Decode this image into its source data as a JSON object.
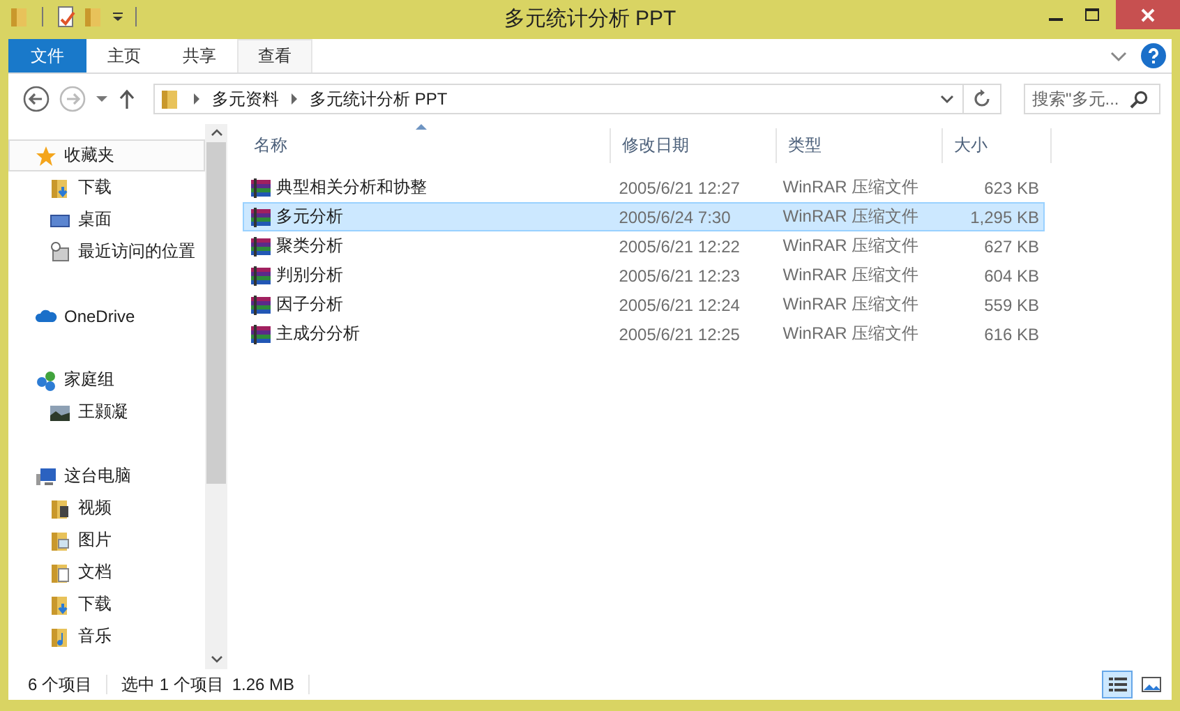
{
  "window": {
    "title": "多元统计分析 PPT"
  },
  "ribbon": {
    "tabs": [
      {
        "label": "文件",
        "kind": "file",
        "selected": false
      },
      {
        "label": "主页",
        "kind": "tab",
        "selected": false
      },
      {
        "label": "共享",
        "kind": "tab",
        "selected": false
      },
      {
        "label": "查看",
        "kind": "tab",
        "selected": true
      }
    ]
  },
  "address": {
    "path": [
      "多元资料",
      "多元统计分析 PPT"
    ]
  },
  "search": {
    "placeholder": "搜索\"多元..."
  },
  "navigation": [
    {
      "label": "收藏夹",
      "kind": "star",
      "selected": true,
      "children": [
        {
          "label": "下载",
          "kind": "download",
          "selected": false
        },
        {
          "label": "桌面",
          "kind": "desktop",
          "selected": false
        },
        {
          "label": "最近访问的位置",
          "kind": "recent",
          "selected": false
        }
      ]
    },
    {
      "label": "OneDrive",
      "kind": "cloud",
      "selected": false
    },
    {
      "label": "家庭组",
      "kind": "homegroup",
      "selected": false,
      "children": [
        {
          "label": "王颢凝",
          "kind": "photo",
          "selected": false
        }
      ]
    },
    {
      "label": "这台电脑",
      "kind": "computer",
      "selected": false,
      "children": [
        {
          "label": "视频",
          "kind": "video",
          "selected": false
        },
        {
          "label": "图片",
          "kind": "pictures",
          "selected": false
        },
        {
          "label": "文档",
          "kind": "documents",
          "selected": false
        },
        {
          "label": "下载",
          "kind": "download",
          "selected": false
        },
        {
          "label": "音乐",
          "kind": "music",
          "selected": false
        }
      ]
    }
  ],
  "table": {
    "columns": [
      {
        "label": "名称",
        "sorted": true
      },
      {
        "label": "修改日期",
        "sorted": false
      },
      {
        "label": "类型",
        "sorted": false
      },
      {
        "label": "大小",
        "sorted": false
      }
    ],
    "rows": [
      {
        "name": "典型相关分析和协整",
        "date": "2005/6/21 12:27",
        "type": "WinRAR 压缩文件",
        "size": "623 KB",
        "selected": false
      },
      {
        "name": "多元分析",
        "date": "2005/6/24 7:30",
        "type": "WinRAR 压缩文件",
        "size": "1,295 KB",
        "selected": true
      },
      {
        "name": "聚类分析",
        "date": "2005/6/21 12:22",
        "type": "WinRAR 压缩文件",
        "size": "627 KB",
        "selected": false
      },
      {
        "name": "判别分析",
        "date": "2005/6/21 12:23",
        "type": "WinRAR 压缩文件",
        "size": "604 KB",
        "selected": false
      },
      {
        "name": "因子分析",
        "date": "2005/6/21 12:24",
        "type": "WinRAR 压缩文件",
        "size": "559 KB",
        "selected": false
      },
      {
        "name": "主成分分析",
        "date": "2005/6/21 12:25",
        "type": "WinRAR 压缩文件",
        "size": "616 KB",
        "selected": false
      }
    ]
  },
  "status_bar": {
    "item_count": "6 个项目",
    "selection": "选中 1 个项目",
    "selection_size": "1.26 MB",
    "views": [
      {
        "kind": "details",
        "selected": true
      },
      {
        "kind": "large-icons",
        "selected": false
      }
    ]
  }
}
